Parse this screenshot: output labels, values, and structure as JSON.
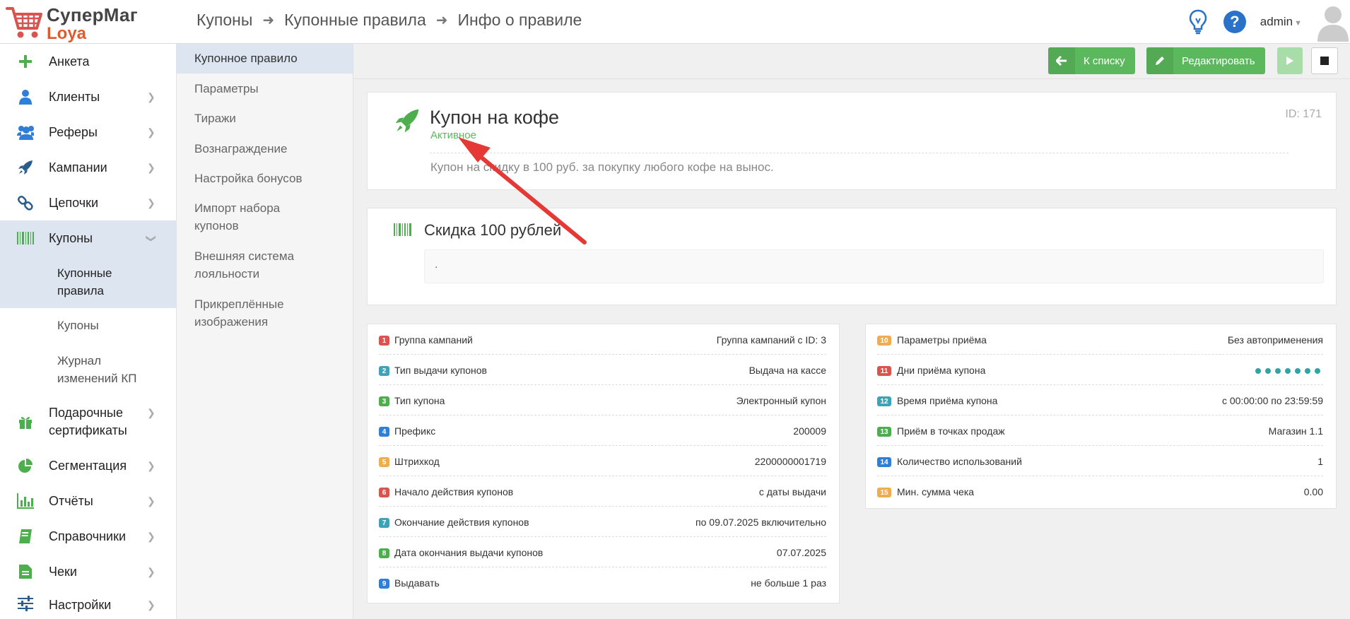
{
  "app": {
    "brand": "СуперМаг",
    "product": "Loya"
  },
  "breadcrumb": [
    "Купоны",
    "Купонные правила",
    "Инфо о правиле"
  ],
  "user": {
    "name": "admin"
  },
  "sidebar": {
    "items": [
      {
        "label": "Анкета",
        "icon": "plus-icon"
      },
      {
        "label": "Клиенты",
        "icon": "user-icon"
      },
      {
        "label": "Реферы",
        "icon": "users-icon"
      },
      {
        "label": "Кампании",
        "icon": "rocket-icon"
      },
      {
        "label": "Цепочки",
        "icon": "link-icon"
      },
      {
        "label": "Купоны",
        "icon": "barcode-icon"
      },
      {
        "label": "Подарочные сертификаты",
        "icon": "gift-icon"
      },
      {
        "label": "Сегментация",
        "icon": "pie-chart-icon"
      },
      {
        "label": "Отчёты",
        "icon": "bar-chart-icon"
      },
      {
        "label": "Справочники",
        "icon": "book-icon"
      },
      {
        "label": "Чеки",
        "icon": "receipt-icon"
      },
      {
        "label": "Настройки",
        "icon": "sliders-icon"
      }
    ],
    "coupon_sub": [
      "Купонные правила",
      "Купоны",
      "Журнал изменений КП"
    ]
  },
  "subnav": [
    "Купонное правило",
    "Параметры",
    "Тиражи",
    "Вознаграждение",
    "Настройка бонусов",
    "Импорт набора купонов",
    "Внешняя система лояльности",
    "Прикреплённые изображения"
  ],
  "toolbar": {
    "back_label": "К списку",
    "edit_label": "Редактировать"
  },
  "rule": {
    "title": "Купон на кофе",
    "status": "Активное",
    "id": "ID: 171",
    "description": "Купон на скидку в 100 руб. за покупку любого кофе на вынос."
  },
  "reward": {
    "title": "Скидка 100 рублей",
    "body": "."
  },
  "params_left": [
    {
      "n": "1",
      "color": "#d9534f",
      "key": "Группа кампаний",
      "value": "Группа кампаний с ID: 3"
    },
    {
      "n": "2",
      "color": "#3fa3b8",
      "key": "Тип выдачи купонов",
      "value": "Выдача на кассе"
    },
    {
      "n": "3",
      "color": "#4cae4c",
      "key": "Тип купона",
      "value": "Электронный купон"
    },
    {
      "n": "4",
      "color": "#2f7ed8",
      "key": "Префикс",
      "value": "200009"
    },
    {
      "n": "5",
      "color": "#f0ad4e",
      "key": "Штрихкод",
      "value": "2200000001719"
    },
    {
      "n": "6",
      "color": "#d9534f",
      "key": "Начало действия купонов",
      "value": "с даты выдачи"
    },
    {
      "n": "7",
      "color": "#3fa3b8",
      "key": "Окончание действия купонов",
      "value": "по 09.07.2025 включительно"
    },
    {
      "n": "8",
      "color": "#4cae4c",
      "key": "Дата окончания выдачи купонов",
      "value": "07.07.2025"
    },
    {
      "n": "9",
      "color": "#2f7ed8",
      "key": "Выдавать",
      "value": "не больше 1 раз"
    }
  ],
  "params_right": [
    {
      "n": "10",
      "color": "#f0ad4e",
      "key": "Параметры приёма",
      "value": "Без автоприменения"
    },
    {
      "n": "11",
      "color": "#d9534f",
      "key": "Дни приёма купона",
      "value": ""
    },
    {
      "n": "12",
      "color": "#3fa3b8",
      "key": "Время приёма купона",
      "value": "с 00:00:00 по 23:59:59"
    },
    {
      "n": "13",
      "color": "#4cae4c",
      "key": "Приём в точках продаж",
      "value": "Магазин 1.1"
    },
    {
      "n": "14",
      "color": "#2f7ed8",
      "key": "Количество использований",
      "value": "1"
    },
    {
      "n": "15",
      "color": "#f0ad4e",
      "key": "Мин. сумма чека",
      "value": "0.00"
    }
  ],
  "colors": {
    "green": "#5cb85c",
    "annotation_arrow": "#e53935",
    "active_bg": "#dde5f0"
  }
}
